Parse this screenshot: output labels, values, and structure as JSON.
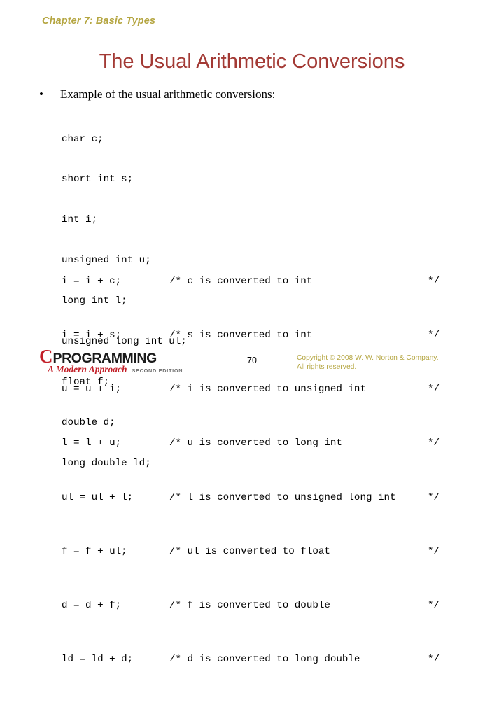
{
  "slide": {
    "chapter_header": "Chapter 7: Basic Types",
    "title": "The Usual Arithmetic Conversions",
    "bullet": {
      "glyph": "•",
      "text": "Example of the usual arithmetic conversions:"
    },
    "declarations": [
      "char c;",
      "short int s;",
      "int i;",
      "unsigned int u;",
      "long int l;",
      "unsigned long int ul;",
      "float f;",
      "double d;",
      "long double ld;"
    ],
    "statements": [
      {
        "code": "i = i + c;",
        "comment_open": "/*",
        "comment_body": " c is converted to int",
        "comment_close": "*/"
      },
      {
        "code": "i = i + s;",
        "comment_open": "/*",
        "comment_body": " s is converted to int",
        "comment_close": "*/"
      },
      {
        "code": "u = u + i;",
        "comment_open": "/*",
        "comment_body": " i is converted to unsigned int",
        "comment_close": "*/"
      },
      {
        "code": "l = l + u;",
        "comment_open": "/*",
        "comment_body": " u is converted to long int",
        "comment_close": "*/"
      },
      {
        "code": "ul = ul + l;",
        "comment_open": "/*",
        "comment_body": " l is converted to unsigned long int",
        "comment_close": "*/"
      },
      {
        "code": "f = f + ul;",
        "comment_open": "/*",
        "comment_body": " ul is converted to float",
        "comment_close": "*/"
      },
      {
        "code": "d = d + f;",
        "comment_open": "/*",
        "comment_body": " f is converted to double",
        "comment_close": "*/"
      },
      {
        "code": "ld = ld + d;",
        "comment_open": "/*",
        "comment_body": " d is converted to long double",
        "comment_close": "*/"
      }
    ]
  },
  "footer": {
    "logo": {
      "letter_c": "C",
      "word": "PROGRAMMING",
      "subtitle": "A Modern Approach",
      "edition": "SECOND EDITION"
    },
    "page_number": "70",
    "copyright_line1": "Copyright © 2008 W. W. Norton & Company.",
    "copyright_line2": "All rights reserved."
  },
  "colors": {
    "background": "#ffffff",
    "chapter_header": "#b5a642",
    "title": "#a33a35",
    "body_text": "#000000",
    "logo_red": "#c21f28",
    "logo_black": "#1a1a1a",
    "edition_grey": "#6e6e6e",
    "copyright": "#b5a642"
  }
}
